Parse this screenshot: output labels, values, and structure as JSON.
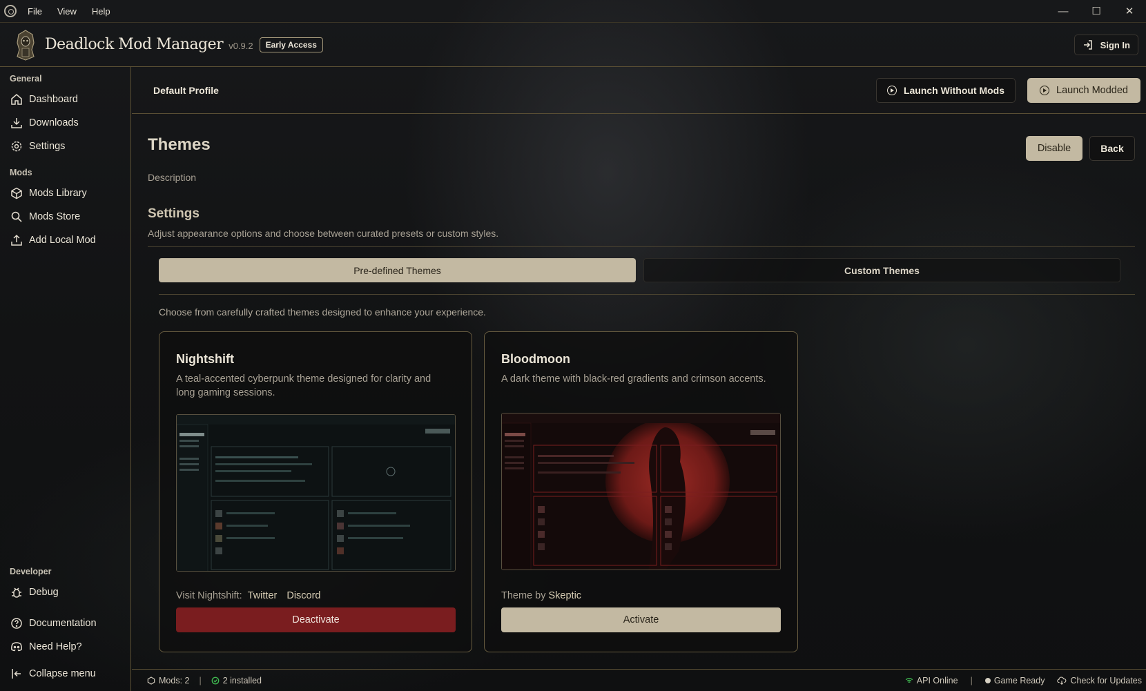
{
  "menu": [
    "File",
    "View",
    "Help"
  ],
  "header": {
    "brand": "Deadlock Mod Manager",
    "version": "v0.9.2",
    "badge": "Early Access",
    "sign_in": "Sign In"
  },
  "sidebar": {
    "general_label": "General",
    "general_items": [
      "Dashboard",
      "Downloads",
      "Settings"
    ],
    "mods_label": "Mods",
    "mods_items": [
      "Mods Library",
      "Mods Store",
      "Add Local Mod"
    ],
    "developer_label": "Developer",
    "developer_items": [
      "Debug"
    ],
    "bottom_items": [
      "Documentation",
      "Need Help?",
      "Collapse menu"
    ]
  },
  "toolbar": {
    "profile": "Default Profile",
    "launch_without": "Launch Without Mods",
    "launch_modded": "Launch Modded"
  },
  "page": {
    "title": "Themes",
    "description": "Description",
    "disable": "Disable",
    "back": "Back",
    "settings_title": "Settings",
    "settings_sub": "Adjust appearance options and choose between curated presets or custom styles.",
    "tabs": [
      "Pre-defined Themes",
      "Custom Themes"
    ],
    "choose_text": "Choose from carefully crafted themes designed to enhance your experience."
  },
  "themes": [
    {
      "name": "Nightshift",
      "description": "A teal-accented cyberpunk theme designed for clarity and long gaming sessions.",
      "visit_label": "Visit Nightshift:",
      "links": [
        "Twitter",
        "Discord"
      ],
      "action": "Deactivate",
      "accent": "#7a1d1f"
    },
    {
      "name": "Bloodmoon",
      "description": "A dark theme with black-red gradients and crimson accents.",
      "by_label": "Theme by",
      "author": "Skeptic",
      "action": "Activate",
      "accent": "#c3b9a2"
    }
  ],
  "footer": {
    "mods": "Mods: 2",
    "installed": "2 installed",
    "api": "API Online",
    "game": "Game Ready",
    "updates": "Check for Updates"
  },
  "colors": {
    "accent_tan": "#c3b9a2",
    "border_gold": "#5a4f34",
    "danger": "#7a1d1f",
    "ok_green": "#3fb950"
  }
}
